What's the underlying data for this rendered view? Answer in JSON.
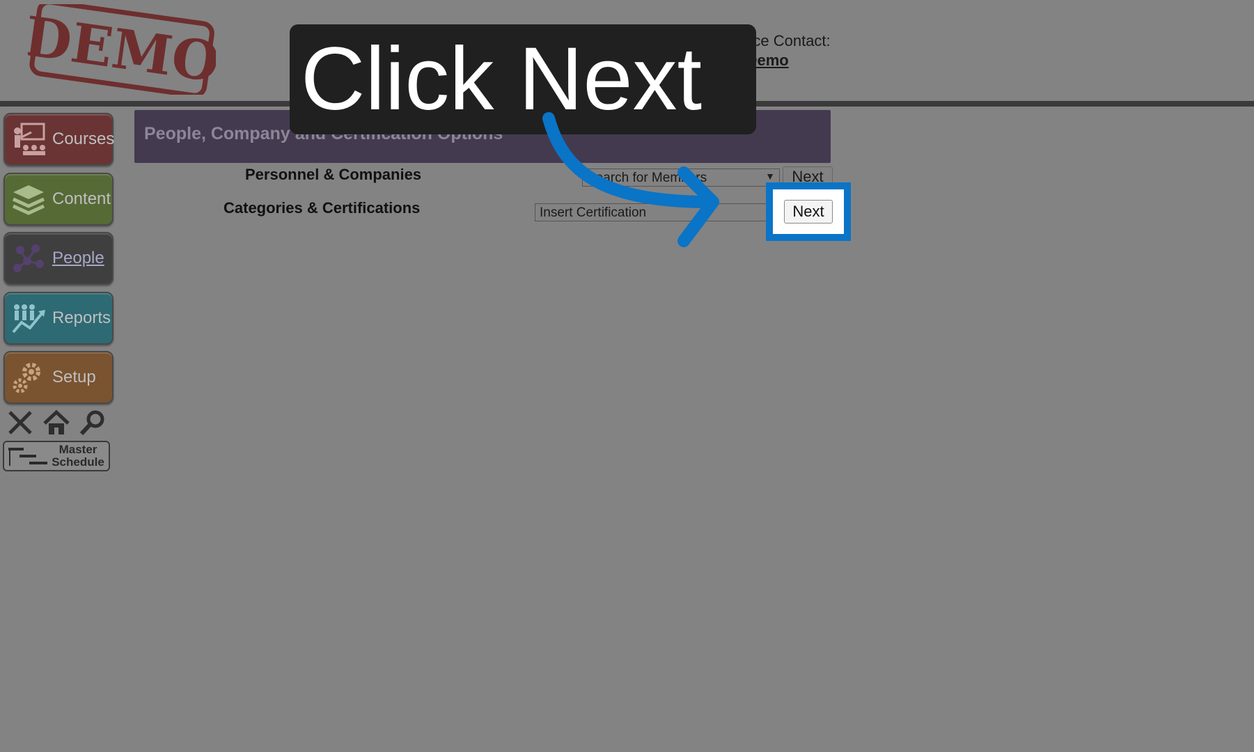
{
  "header": {
    "stamp_text": "DEMO",
    "assistance_label": "For Assistance Contact:",
    "assistance_contact": "Vbiz Demo"
  },
  "sidebar": {
    "items": [
      {
        "label": "Courses",
        "icon": "presentation-icon",
        "color": "#6a3434"
      },
      {
        "label": "Content",
        "icon": "books-stack-icon",
        "color": "#566a36"
      },
      {
        "label": "People",
        "icon": "people-network-icon",
        "color": "#3f3f3f"
      },
      {
        "label": "Reports",
        "icon": "trend-chart-icon",
        "color": "#2d6a74"
      },
      {
        "label": "Setup",
        "icon": "gears-icon",
        "color": "#7a5330"
      }
    ],
    "utilities": [
      "close-icon",
      "home-icon",
      "search-icon"
    ],
    "master_schedule": {
      "line1": "Master",
      "line2": "Schedule"
    }
  },
  "main": {
    "section_title": "People, Company and Certification Options",
    "rows": [
      {
        "label": "Personnel & Companies",
        "select_value": "Search for Members",
        "button": "Next"
      },
      {
        "label": "Categories & Certifications",
        "select_value": "Insert Certification",
        "button": "Next"
      }
    ]
  },
  "overlay": {
    "instruction": "Click Next",
    "highlight_color": "#0a74c7"
  }
}
